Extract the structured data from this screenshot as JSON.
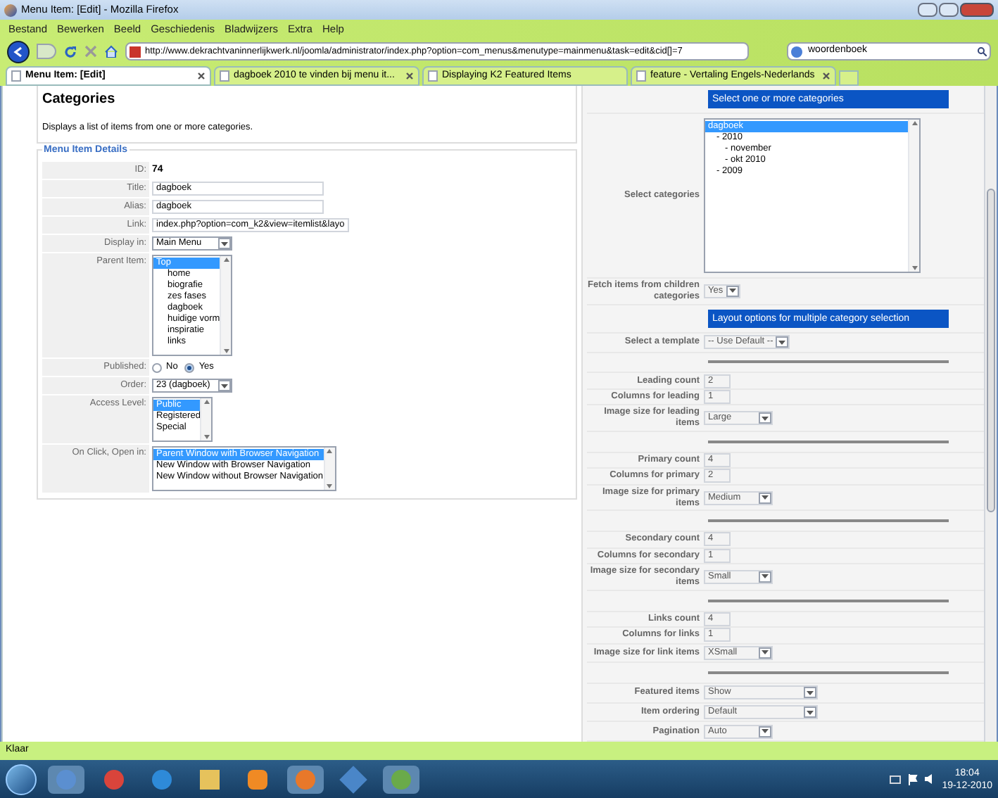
{
  "window": {
    "title": "Menu Item: [Edit] - Mozilla Firefox"
  },
  "menu": [
    "Bestand",
    "Bewerken",
    "Beeld",
    "Geschiedenis",
    "Bladwijzers",
    "Extra",
    "Help"
  ],
  "address": {
    "value": "http://www.dekrachtvaninnerlijkwerk.nl/joomla/administrator/index.php?option=com_menus&menutype=mainmenu&task=edit&cid[]=7"
  },
  "search": {
    "value": "woordenboek"
  },
  "tabs": [
    {
      "label": "Menu Item: [Edit]",
      "selected": true,
      "closable": true
    },
    {
      "label": "dagboek 2010 te vinden bij menu it...",
      "selected": false,
      "closable": true
    },
    {
      "label": "Displaying K2 Featured Items",
      "selected": false,
      "closable": false
    },
    {
      "label": "feature - Vertaling Engels-Nederlands",
      "selected": false,
      "closable": true
    }
  ],
  "left": {
    "heading": "Categories",
    "description": "Displays a list of items from one or more categories.",
    "section": "Menu Item Details",
    "rows": [
      {
        "kind": "text",
        "label": "ID:",
        "value": "74"
      },
      {
        "kind": "input",
        "label": "Title:",
        "value": "dagboek"
      },
      {
        "kind": "input",
        "label": "Alias:",
        "value": "dagboek"
      },
      {
        "kind": "input",
        "label": "Link:",
        "value": "index.php?option=com_k2&view=itemlist&layo"
      },
      {
        "kind": "select",
        "label": "Display in:",
        "value": "Main Menu"
      },
      {
        "kind": "listbox",
        "label": "Parent Item:",
        "options": [
          {
            "label": "Top",
            "selected": true,
            "children": [
              {
                "label": "home",
                "selected": false
              },
              {
                "label": "biografie",
                "selected": false
              },
              {
                "label": "zes fases",
                "selected": false
              },
              {
                "label": "dagboek",
                "selected": false
              },
              {
                "label": "huidige vorm",
                "selected": false
              },
              {
                "label": "inspiratie",
                "selected": false
              },
              {
                "label": "links",
                "selected": false
              }
            ]
          }
        ]
      },
      {
        "kind": "radio",
        "label": "Published:",
        "options": [
          {
            "label": "No",
            "selected": false
          },
          {
            "label": "Yes",
            "selected": true
          }
        ]
      },
      {
        "kind": "select",
        "label": "Order:",
        "value": "23 (dagboek)"
      },
      {
        "kind": "listbox",
        "label": "Access Level:",
        "options": [
          {
            "label": "Public",
            "selected": true
          },
          {
            "label": "Registered",
            "selected": false
          },
          {
            "label": "Special",
            "selected": false
          }
        ]
      },
      {
        "kind": "listbox",
        "label": "On Click, Open in:",
        "options": [
          {
            "label": "Parent Window with Browser Navigation",
            "selected": true
          },
          {
            "label": "New Window with Browser Navigation",
            "selected": false
          },
          {
            "label": "New Window without Browser Navigation",
            "selected": false
          }
        ]
      }
    ]
  },
  "right": {
    "rows": [
      {
        "kind": "header",
        "text": "Select one or more categories"
      },
      {
        "kind": "listbox",
        "label": "Select categories",
        "options": [
          {
            "label": "dagboek",
            "selected": true,
            "children": [
              {
                "label": "- 2010",
                "selected": false,
                "children": [
                  {
                    "label": "- november",
                    "selected": false
                  },
                  {
                    "label": "- okt 2010",
                    "selected": false
                  }
                ]
              },
              {
                "label": "- 2009",
                "selected": false
              }
            ]
          }
        ]
      },
      {
        "kind": "select",
        "label": "Fetch items from children categories",
        "value": "Yes"
      },
      {
        "kind": "header",
        "text": "Layout options for multiple category selection"
      },
      {
        "kind": "select",
        "label": "Select a template",
        "value": "-- Use Default --"
      },
      {
        "kind": "divider"
      },
      {
        "kind": "input",
        "label": "Leading count",
        "value": "2"
      },
      {
        "kind": "input",
        "label": "Columns for leading",
        "value": "1"
      },
      {
        "kind": "select",
        "label": "Image size for leading items",
        "value": "Large"
      },
      {
        "kind": "divider"
      },
      {
        "kind": "input",
        "label": "Primary count",
        "value": "4"
      },
      {
        "kind": "input",
        "label": "Columns for primary",
        "value": "2"
      },
      {
        "kind": "select",
        "label": "Image size for primary items",
        "value": "Medium"
      },
      {
        "kind": "divider"
      },
      {
        "kind": "input",
        "label": "Secondary count",
        "value": "4"
      },
      {
        "kind": "input",
        "label": "Columns for secondary",
        "value": "1"
      },
      {
        "kind": "select",
        "label": "Image size for secondary items",
        "value": "Small"
      },
      {
        "kind": "divider"
      },
      {
        "kind": "input",
        "label": "Links count",
        "value": "4"
      },
      {
        "kind": "input",
        "label": "Columns for links",
        "value": "1"
      },
      {
        "kind": "select",
        "label": "Image size for link items",
        "value": "XSmall"
      },
      {
        "kind": "divider"
      },
      {
        "kind": "wideselect",
        "label": "Featured items",
        "value": "Show"
      },
      {
        "kind": "wideselect",
        "label": "Item ordering",
        "value": "Default"
      },
      {
        "kind": "select",
        "label": "Pagination",
        "value": "Auto"
      }
    ]
  },
  "status_bar": {
    "text": "Klaar"
  },
  "clock": {
    "time": "18:04",
    "date": "19-12-2010"
  }
}
